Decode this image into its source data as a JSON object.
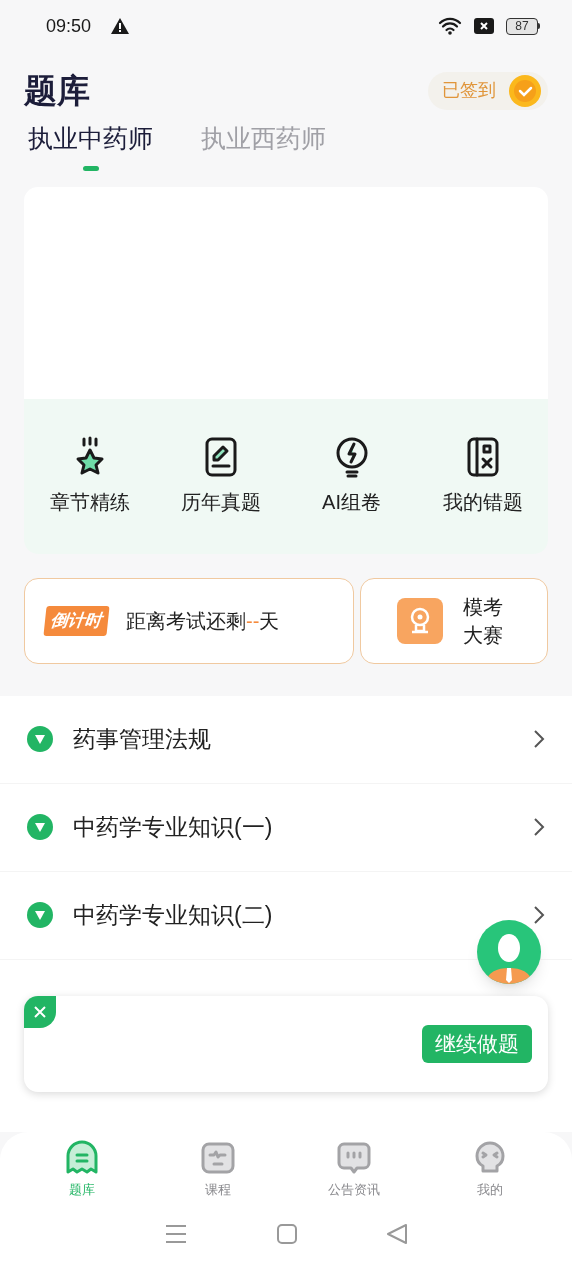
{
  "status_bar": {
    "time": "09:50",
    "battery": "87"
  },
  "header": {
    "title": "题库",
    "checkin": "已签到"
  },
  "tabs": [
    {
      "label": "执业中药师",
      "selected": true
    },
    {
      "label": "执业西药师",
      "selected": false
    }
  ],
  "features": [
    {
      "kind": "star",
      "label": "章节精练"
    },
    {
      "kind": "pen",
      "label": "历年真题"
    },
    {
      "kind": "bolt",
      "label": "AI组卷"
    },
    {
      "kind": "mistake",
      "label": "我的错题"
    }
  ],
  "countdown": {
    "badge": "倒计时",
    "prefix": "距离考试还剩",
    "days": "--",
    "suffix": "天"
  },
  "mock_exam": {
    "label": "模考大赛"
  },
  "subjects": [
    {
      "title": "药事管理法规"
    },
    {
      "title": "中药学专业知识(一)"
    },
    {
      "title": "中药学专业知识(二)"
    }
  ],
  "resume_popup": {
    "button": "继续做题"
  },
  "bottom_nav": [
    {
      "kind": "ghost",
      "label": "题库",
      "selected": true
    },
    {
      "kind": "screen",
      "label": "课程",
      "selected": false
    },
    {
      "kind": "chat",
      "label": "公告资讯",
      "selected": false
    },
    {
      "kind": "face",
      "label": "我的",
      "selected": false
    }
  ]
}
